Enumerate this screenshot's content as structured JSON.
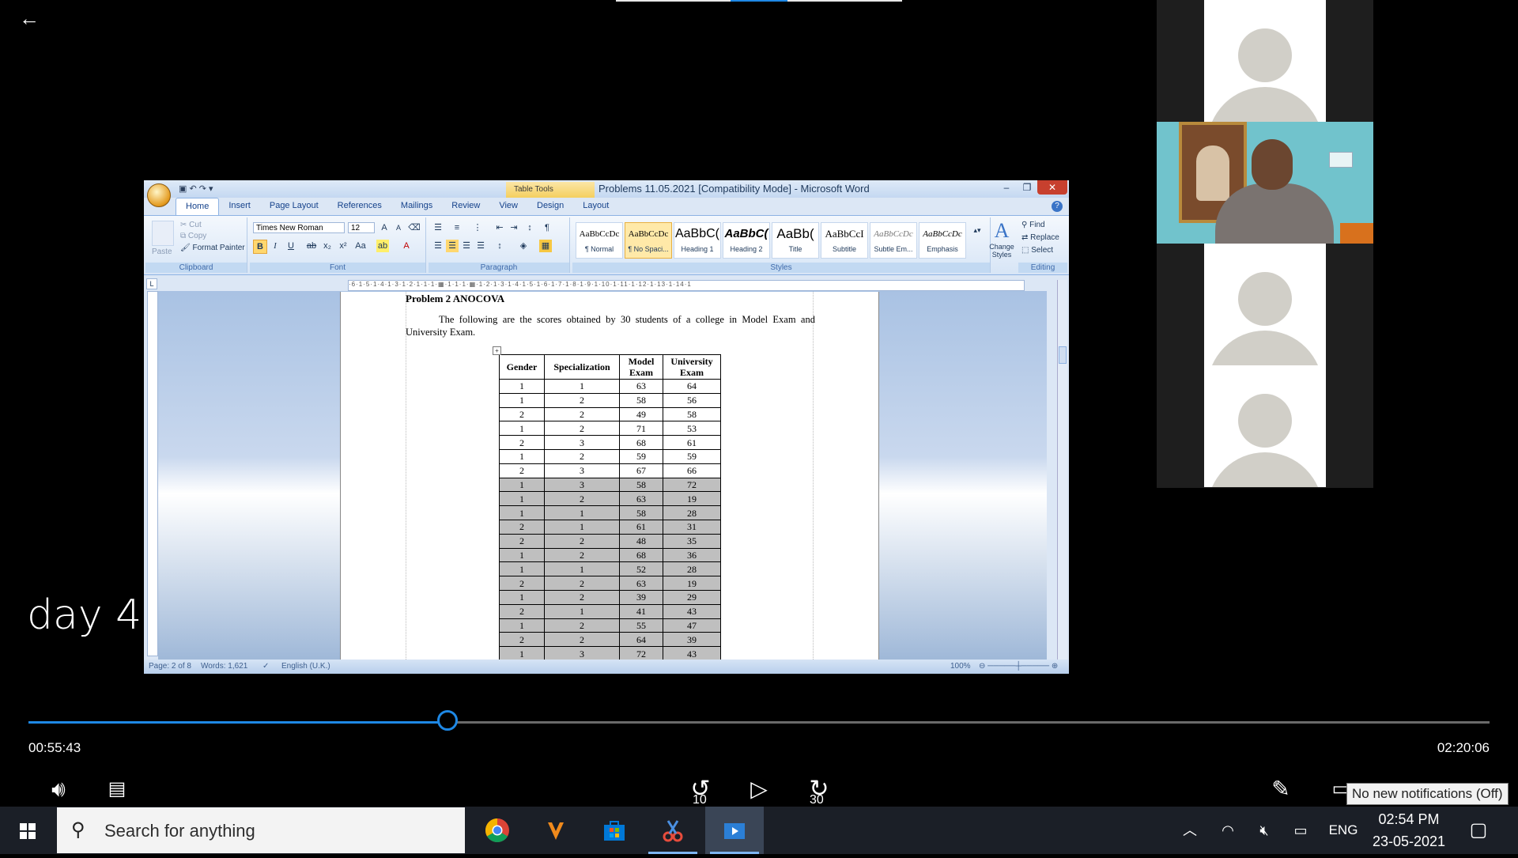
{
  "player": {
    "video_title": "day 4",
    "time_current": "00:55:43",
    "time_total": "02:20:06",
    "progress_fraction": 0.287,
    "skip_back_seconds": "10",
    "skip_forward_seconds": "30",
    "notification_tooltip": "No new notifications (Off)"
  },
  "word": {
    "window_title": "Problems 11.05.2021 [Compatibility Mode] - Microsoft Word",
    "contextual_tab_group": "Table Tools",
    "tabs": [
      "Home",
      "Insert",
      "Page Layout",
      "References",
      "Mailings",
      "Review",
      "View",
      "Design",
      "Layout"
    ],
    "active_tab": "Home",
    "clipboard": {
      "paste": "Paste",
      "cut": "Cut",
      "copy": "Copy",
      "format_painter": "Format Painter",
      "label": "Clipboard"
    },
    "font": {
      "name": "Times New Roman",
      "size": "12",
      "label": "Font"
    },
    "paragraph_label": "Paragraph",
    "styles": [
      {
        "sample": "AaBbCcDc",
        "name": "¶ Normal"
      },
      {
        "sample": "AaBbCcDc",
        "name": "¶ No Spaci..."
      },
      {
        "sample": "AaBbC(",
        "name": "Heading 1"
      },
      {
        "sample": "AaBbC(",
        "name": "Heading 2"
      },
      {
        "sample": "AaBb(",
        "name": "Title"
      },
      {
        "sample": "AaBbCcI",
        "name": "Subtitle"
      },
      {
        "sample": "AaBbCcDc",
        "name": "Subtle Em..."
      },
      {
        "sample": "AaBbCcDc",
        "name": "Emphasis"
      }
    ],
    "selected_style": "¶ No Spaci...",
    "styles_label": "Styles",
    "change_styles": "Change Styles",
    "editing": {
      "find": "Find",
      "replace": "Replace",
      "select": "Select",
      "label": "Editing"
    },
    "status": {
      "page": "Page: 2 of 8",
      "words": "Words: 1,621",
      "language": "English (U.K.)",
      "zoom": "100%"
    },
    "ruler_text": "·6·1·5·1·4·1·3·1·2·1·1·1·▦·1·1·1·▦·1·2·1·3·1·4·1·5·1·6·1·7·1·8·1·9·1·10·1·11·1·12·1·13·1·14·1"
  },
  "document": {
    "heading": "Problem 2 ANOCOVA",
    "paragraph": "The following are the scores obtained by 30 students of a college in Model Exam and University Exam.",
    "table_headers": [
      "Gender",
      "Specialization",
      "Model Exam",
      "University Exam"
    ],
    "table_rows": [
      [
        "1",
        "1",
        "63",
        "64"
      ],
      [
        "1",
        "2",
        "58",
        "56"
      ],
      [
        "2",
        "2",
        "49",
        "58"
      ],
      [
        "1",
        "2",
        "71",
        "53"
      ],
      [
        "2",
        "3",
        "68",
        "61"
      ],
      [
        "1",
        "2",
        "59",
        "59"
      ],
      [
        "2",
        "3",
        "67",
        "66"
      ],
      [
        "1",
        "3",
        "58",
        "72"
      ],
      [
        "1",
        "2",
        "63",
        "19"
      ],
      [
        "1",
        "1",
        "58",
        "28"
      ],
      [
        "2",
        "1",
        "61",
        "31"
      ],
      [
        "2",
        "2",
        "48",
        "35"
      ],
      [
        "1",
        "2",
        "68",
        "36"
      ],
      [
        "1",
        "1",
        "52",
        "28"
      ],
      [
        "2",
        "2",
        "63",
        "19"
      ],
      [
        "1",
        "2",
        "39",
        "29"
      ],
      [
        "2",
        "1",
        "41",
        "43"
      ],
      [
        "1",
        "2",
        "55",
        "47"
      ],
      [
        "2",
        "2",
        "64",
        "39"
      ],
      [
        "1",
        "3",
        "72",
        "43"
      ]
    ]
  },
  "taskbar": {
    "search_placeholder": "Search for anything",
    "language": "ENG",
    "time": "02:54 PM",
    "date": "23-05-2021"
  }
}
